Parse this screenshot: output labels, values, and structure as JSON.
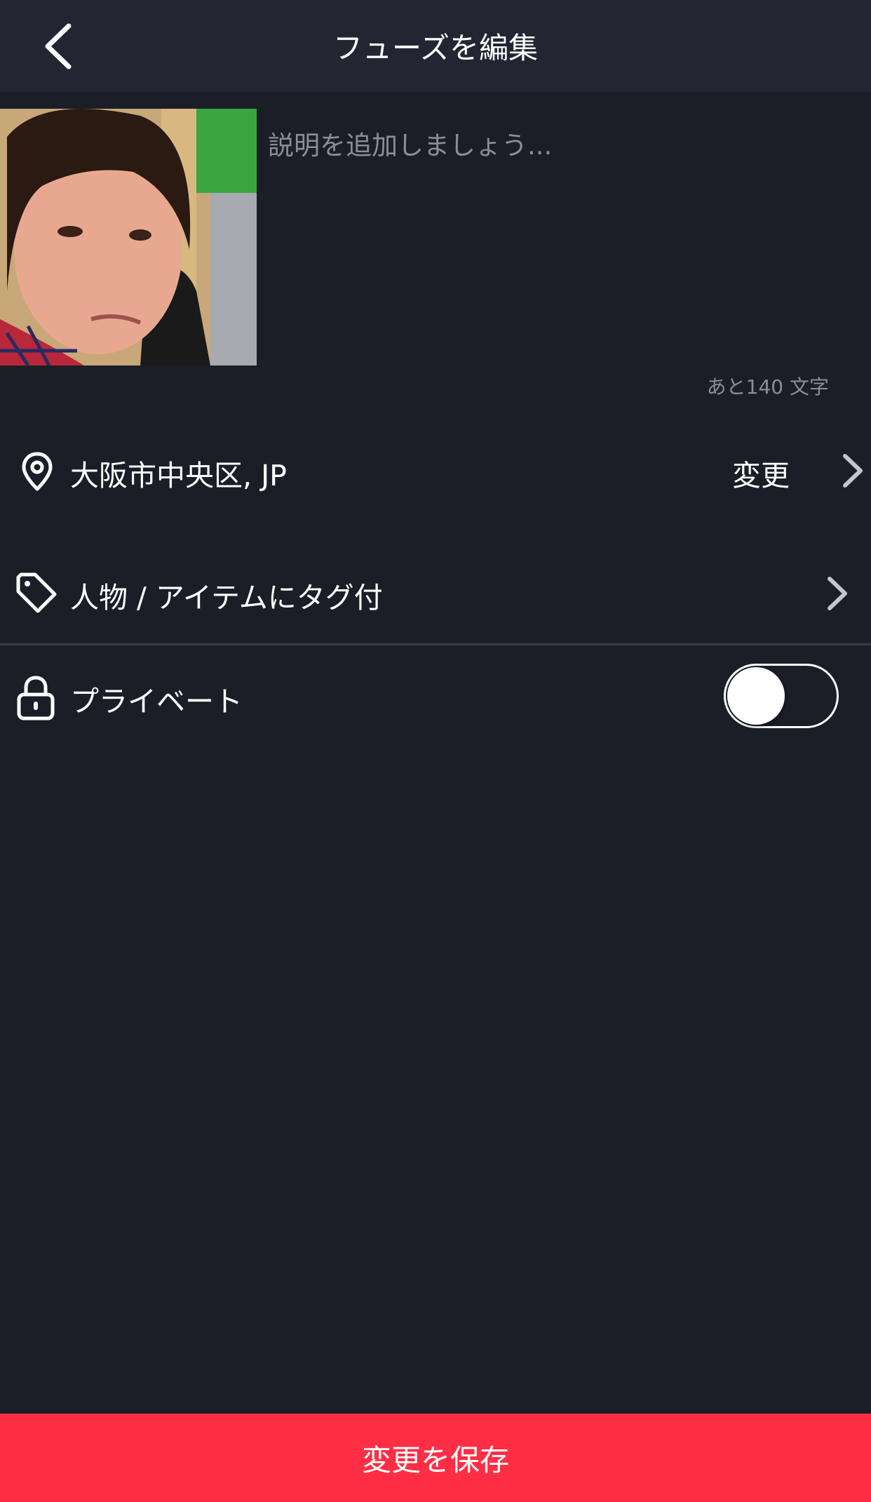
{
  "header": {
    "title": "フューズを編集",
    "back_icon": "chevron-left-icon"
  },
  "photo": {
    "description": "selfie photo thumbnail"
  },
  "caption": {
    "placeholder": "説明を追加しましょう...",
    "value": "",
    "remaining_label": "あと140 文字"
  },
  "location": {
    "icon": "map-pin-icon",
    "label": "大阪市中央区, JP",
    "change_label": "変更"
  },
  "tags": {
    "icon": "tag-icon",
    "label": "人物 / アイテムにタグ付"
  },
  "privacy": {
    "icon": "lock-icon",
    "label": "プライベート",
    "enabled": false
  },
  "footer": {
    "save_label": "変更を保存"
  },
  "colors": {
    "background": "#1b1e27",
    "header": "#232632",
    "accent": "#ff2e44",
    "muted_text": "#8b8e98"
  }
}
